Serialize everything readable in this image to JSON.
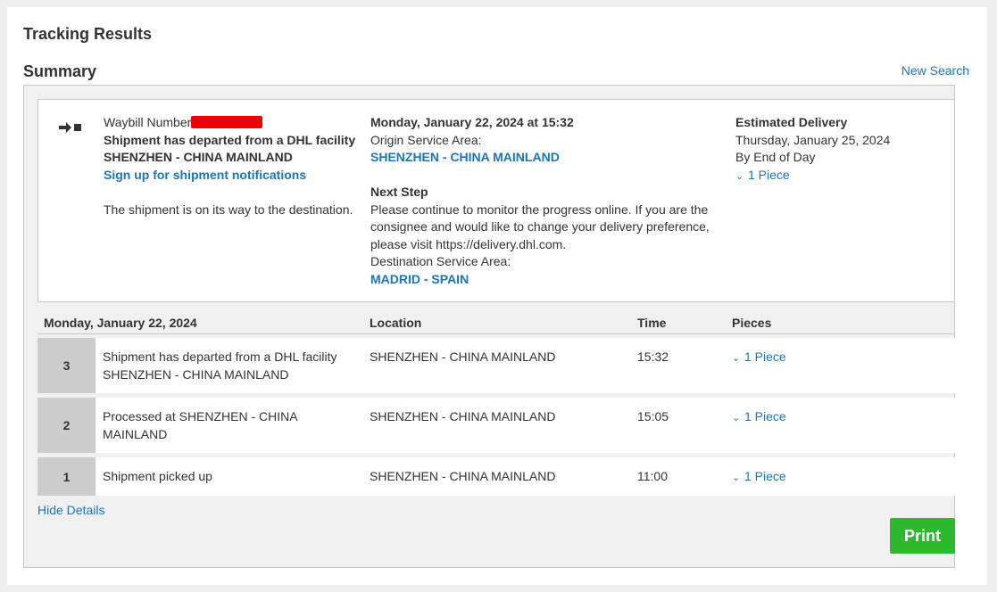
{
  "header": {
    "title": "Tracking Results",
    "summary_title": "Summary",
    "new_search": "New Search"
  },
  "summary": {
    "waybill_label": "Waybill Number",
    "status_line1": "Shipment has departed from a DHL facility",
    "status_line2": "SHENZHEN - CHINA MAINLAND",
    "signup_link": "Sign up for shipment notifications",
    "status_note": "The shipment is on its way to the destination.",
    "datetime": "Monday, January 22, 2024 at 15:32",
    "origin_label": "Origin Service Area:",
    "origin_value": "SHENZHEN - CHINA MAINLAND",
    "next_step_label": "Next Step",
    "next_step_text": "Please continue to monitor the progress online. If you are the consignee and would like to change your delivery preference, please visit https://delivery.dhl.com.",
    "destination_label": "Destination Service Area:",
    "destination_value": "MADRID - SPAIN",
    "est_label": "Estimated Delivery",
    "est_date": "Thursday, January 25, 2024",
    "est_time": "By End of Day",
    "pieces": "1 Piece"
  },
  "table": {
    "headers": {
      "date": "Monday, January 22, 2024",
      "location": "Location",
      "time": "Time",
      "pieces": "Pieces"
    },
    "rows": [
      {
        "num": "3",
        "event": "Shipment has departed from a DHL facility SHENZHEN - CHINA MAINLAND",
        "location": "SHENZHEN - CHINA MAINLAND",
        "time": "15:32",
        "pieces": "1 Piece"
      },
      {
        "num": "2",
        "event": "Processed at SHENZHEN - CHINA MAINLAND",
        "location": "SHENZHEN - CHINA MAINLAND",
        "time": "15:05",
        "pieces": "1 Piece"
      },
      {
        "num": "1",
        "event": "Shipment picked up",
        "location": "SHENZHEN - CHINA MAINLAND",
        "time": "11:00",
        "pieces": "1 Piece"
      }
    ]
  },
  "footer": {
    "hide_details": "Hide Details",
    "print": "Print"
  },
  "colors": {
    "link": "#1a75bb",
    "print_button": "#2eb82e",
    "redaction": "#ee0000"
  }
}
